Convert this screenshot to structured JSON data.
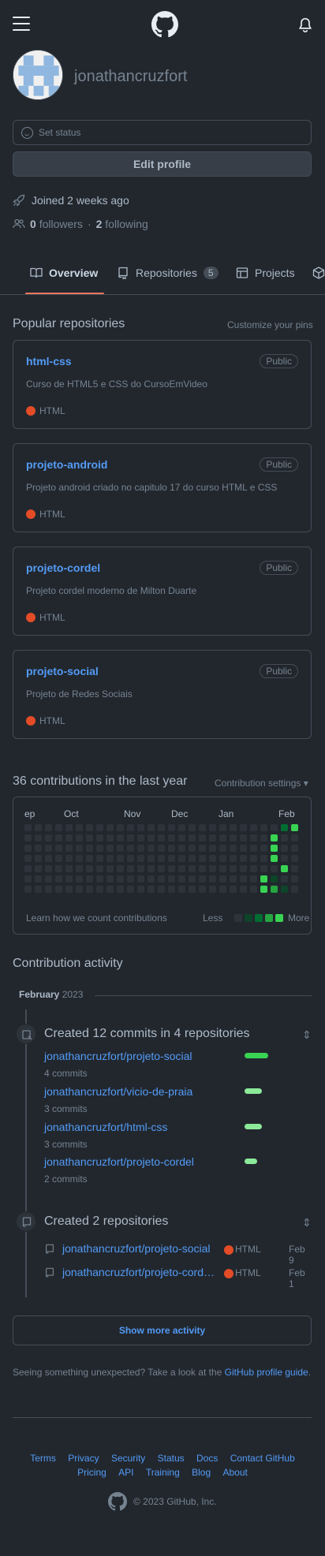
{
  "header": {
    "menu_icon": "hamburger-icon",
    "logo_icon": "github-logo-icon",
    "notif_icon": "bell-icon"
  },
  "profile": {
    "username": "jonathancruzfort",
    "status_placeholder": "Set status",
    "edit_label": "Edit profile",
    "joined": "Joined 2 weeks ago",
    "followers_count": "0",
    "followers_label": "followers",
    "separator": "·",
    "following_count": "2",
    "following_label": "following"
  },
  "tabs": [
    {
      "label": "Overview",
      "icon": "book-icon"
    },
    {
      "label": "Repositories",
      "icon": "repo-icon",
      "count": "5"
    },
    {
      "label": "Projects",
      "icon": "table-icon"
    },
    {
      "label": "",
      "icon": "package-icon"
    }
  ],
  "popular": {
    "title": "Popular repositories",
    "customize": "Customize your pins",
    "repos": [
      {
        "name": "html-css",
        "visibility": "Public",
        "description": "Curso de HTML5 e CSS do CursoEmVideo",
        "language": "HTML"
      },
      {
        "name": "projeto-android",
        "visibility": "Public",
        "description": "Projeto android criado no capitulo 17 do curso HTML e CSS",
        "language": "HTML"
      },
      {
        "name": "projeto-cordel",
        "visibility": "Public",
        "description": "Projeto cordel moderno de Milton Duarte",
        "language": "HTML"
      },
      {
        "name": "projeto-social",
        "visibility": "Public",
        "description": "Projeto de Redes Sociais",
        "language": "HTML"
      }
    ]
  },
  "contributions": {
    "title": "36 contributions in the last year",
    "settings": "Contribution settings",
    "months": [
      "ep",
      "Oct",
      "Nov",
      "Dec",
      "Jan",
      "Feb"
    ],
    "learn": "Learn how we count contributions",
    "less": "Less",
    "more": "More",
    "colors": {
      "empty": "#2d333b",
      "l1": "#0e4429",
      "l2": "#006d32",
      "l3": "#26a641",
      "l4": "#39d353"
    }
  },
  "activity": {
    "title": "Contribution activity",
    "month": "February",
    "year": "2023",
    "commits_group": {
      "title": "Created 12 commits in 4 repositories",
      "items": [
        {
          "repo": "jonathancruzfort/projeto-social",
          "commits": "4 commits"
        },
        {
          "repo": "jonathancruzfort/vicio-de-praia",
          "commits": "3 commits"
        },
        {
          "repo": "jonathancruzfort/html-css",
          "commits": "3 commits"
        },
        {
          "repo": "jonathancruzfort/projeto-cordel",
          "commits": "2 commits"
        }
      ]
    },
    "repos_group": {
      "title": "Created 2 repositories",
      "items": [
        {
          "repo": "jonathancruzfort/projeto-social",
          "language": "HTML",
          "date": "Feb 9"
        },
        {
          "repo": "jonathancruzfort/projeto-cord…",
          "language": "HTML",
          "date": "Feb 1"
        }
      ]
    },
    "show_more": "Show more activity",
    "unexpected": "Seeing something unexpected? Take a look at the ",
    "guide_link": "GitHub profile guide",
    "period": "."
  },
  "footer": {
    "row1": [
      "Terms",
      "Privacy",
      "Security",
      "Status",
      "Docs",
      "Contact GitHub"
    ],
    "row2": [
      "Pricing",
      "API",
      "Training",
      "Blog",
      "About"
    ],
    "copyright": "© 2023 GitHub, Inc."
  }
}
